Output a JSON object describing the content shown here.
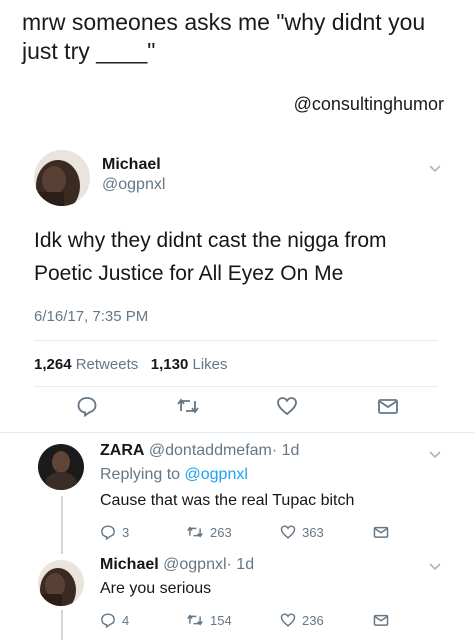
{
  "caption": "mrw someones asks me \"why didnt you just try ____\"",
  "credit_handle": "@consultinghumor",
  "main_tweet": {
    "name": "Michael",
    "handle": "@ogpnxl",
    "text": "Idk why they didnt cast the nigga from Poetic Justice for All Eyez On Me",
    "date": "6/16/17, 7:35 PM",
    "retweets_count": "1,264",
    "retweets_label": "Retweets",
    "likes_count": "1,130",
    "likes_label": "Likes"
  },
  "replies": [
    {
      "name": "ZARA",
      "handle": "@dontaddmefam",
      "time": "· 1d",
      "replying_prefix": "Replying to",
      "replying_handle": "@ogpnxl",
      "text": "Cause that was the real Tupac bitch",
      "reply_count": "3",
      "retweet_count": "263",
      "like_count": "363"
    },
    {
      "name": "Michael",
      "handle": "@ogpnxl",
      "time": "· 1d",
      "text": "Are you serious",
      "reply_count": "4",
      "retweet_count": "154",
      "like_count": "236"
    }
  ],
  "icons": {
    "reply": "reply-icon",
    "retweet": "retweet-icon",
    "like": "heart-icon",
    "dm": "envelope-icon",
    "more": "chevron-down-icon"
  },
  "colors": {
    "text": "#14171a",
    "grey": "#657786",
    "link": "#1da1f2",
    "divider": "#e6ecf0"
  }
}
